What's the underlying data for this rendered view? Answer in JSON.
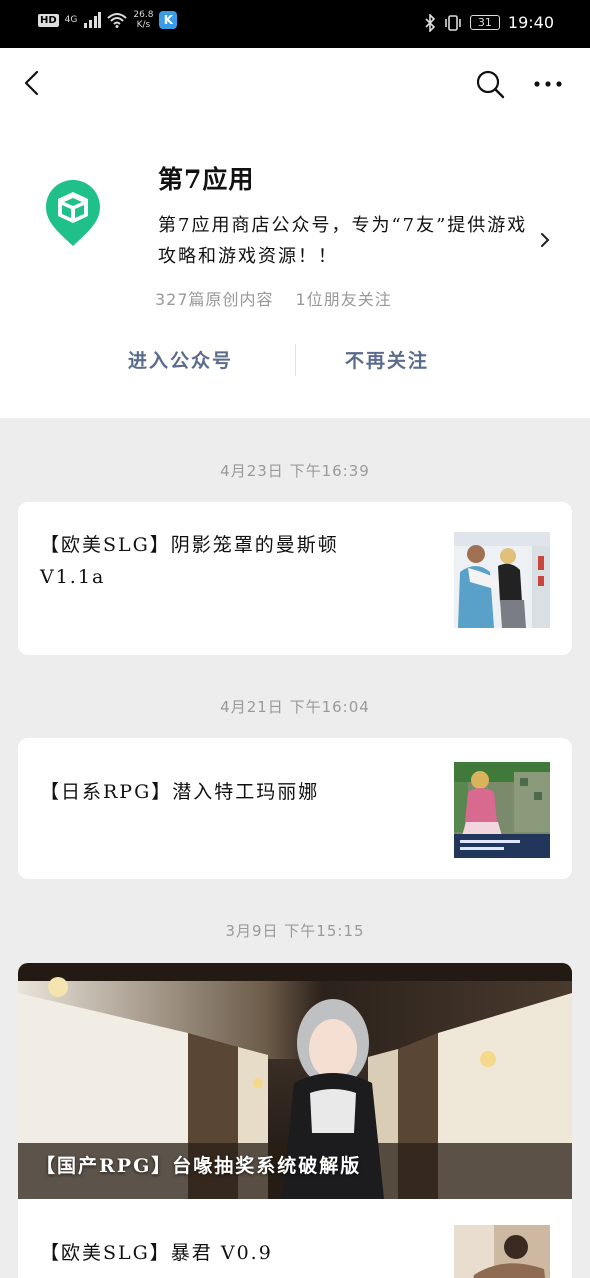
{
  "status_bar": {
    "hd_badge": "HD",
    "network_type": "4G",
    "speed_value": "26.8",
    "speed_unit": "K/s",
    "app_badge": "K",
    "battery": "31",
    "time": "19:40"
  },
  "header": {
    "back_icon": "back-arrow-icon",
    "search_icon": "search-icon",
    "more_icon": "more-icon"
  },
  "account": {
    "name": "第7应用",
    "description": "第7应用商店公众号，专为“7友”提供游戏攻略和游戏资源！！",
    "original_count": "327篇原创内容",
    "friends_following": "1位朋友关注",
    "logo_color": "#1fc089",
    "enter_label": "进入公众号",
    "unfollow_label": "不再关注",
    "action_color": "#5a6b8c"
  },
  "feed": [
    {
      "date": "4月23日  下午16:39",
      "articles": [
        {
          "title_line1": "【欧美SLG】阴影笼罩的曼斯顿",
          "title_line2": "V1.1a"
        }
      ]
    },
    {
      "date": "4月21日  下午16:04",
      "articles": [
        {
          "title_line1": "【日系RPG】潜入特工玛丽娜"
        }
      ]
    },
    {
      "date": "3月9日  下午15:15",
      "articles": [
        {
          "title": "【国产RPG】台喙抽奖系统破解版"
        },
        {
          "title": "【欧美SLG】暴君 V0.9"
        }
      ]
    }
  ]
}
